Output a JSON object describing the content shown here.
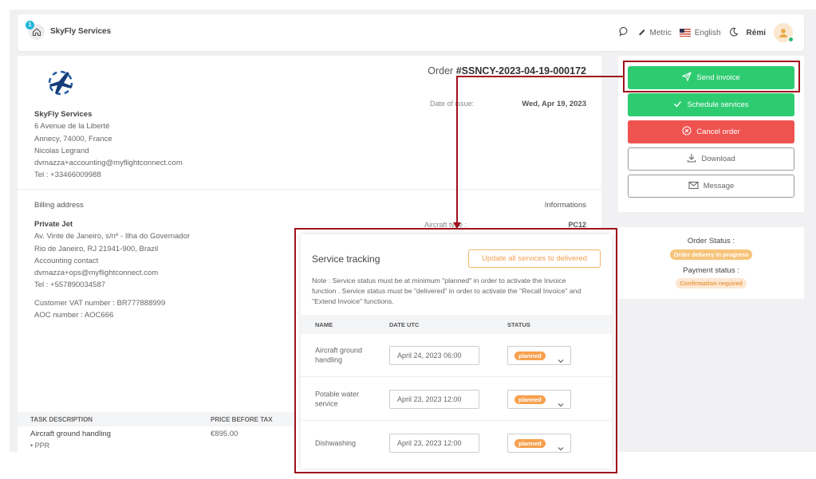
{
  "header": {
    "notif_count": "1",
    "app_name": "SkyFly Services",
    "unit": "Metric",
    "language": "English",
    "user_name": "Rémi"
  },
  "order": {
    "title_prefix": "Order",
    "number": "#SSNCY-2023-04-19-000172",
    "issue_label": "Date of issue:",
    "issue_date": "Wed, Apr 19, 2023"
  },
  "company": {
    "name": "SkyFly Services",
    "address1": "6 Avenue de la Liberté",
    "address2": "Annecy,  74000,  France",
    "contact": "Nicolas Legrand",
    "email": "dvmazza+accounting@myflightconnect.com",
    "tel": "Tel : +33466009988"
  },
  "billing": {
    "label": "Billing address",
    "name": "Private Jet",
    "address1": "Av. Vinte de Janeiro, s/nº - Ilha do Governador",
    "address2": "Rio de Janeiro,  RJ 21941-900,  Brazil",
    "contact": "Accounting contact",
    "email": "dvmazza+ops@myflightconnect.com",
    "tel": "Tel : +557890034587",
    "vat": "Customer VAT number : BR777888999",
    "aoc": "AOC number : AOC666"
  },
  "informations": {
    "label": "Informations",
    "aircraft_type_label": "Aircraft type :",
    "aircraft_type_value": "PC12"
  },
  "tasks": {
    "col_desc": "TASK DESCRIPTION",
    "col_price": "PRICE BEFORE TAX",
    "row1_desc": "Aircraft ground handling",
    "row1_sub": "• PPR",
    "row1_price": "€895.00"
  },
  "actions": {
    "send_invoice": "Send invoice",
    "schedule_services": "Schedule services",
    "cancel_order": "Cancel order",
    "download": "Download",
    "message": "Message"
  },
  "status": {
    "order_label": "Order Status :",
    "order_value": "Order delivery in progress",
    "payment_label": "Payment status :",
    "payment_value": "Confirmation required"
  },
  "service_tracking": {
    "title": "Service tracking",
    "update_all": "Update all services to delivered",
    "note": "Note : Service status must be at minimum \"planned\" in order to activate the Invoice function . Service status must be \"delivered\" in order to activate the \"Recall Invoice\" and \"Extend Invoice\" functions.",
    "col_name": "NAME",
    "col_date": "DATE UTC",
    "col_status": "STATUS",
    "rows": [
      {
        "name": "Aircraft ground handling",
        "date": "April 24, 2023 06:00",
        "status": "planned"
      },
      {
        "name": "Potable water service",
        "date": "April 23, 2023 12:00",
        "status": "planned"
      },
      {
        "name": "Dishwashing",
        "date": "April 23, 2023 12:00",
        "status": "planned"
      }
    ]
  },
  "colors": {
    "green": "#2ecc71",
    "red": "#ef5350",
    "orange": "#f6a04d",
    "annotation": "#a0101c"
  }
}
